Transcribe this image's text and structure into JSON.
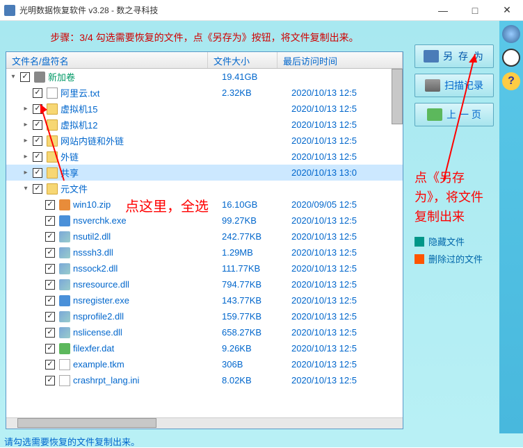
{
  "window": {
    "title": "光明数据恢复软件 v3.28 - 数之寻科技"
  },
  "step_text": "步骤：3/4 勾选需要恢复的文件，点《另存为》按钮，将文件复制出来。",
  "headers": {
    "name": "文件名/盘符名",
    "size": "文件大小",
    "time": "最后访问时间"
  },
  "files": [
    {
      "indent": 0,
      "expand": "▾",
      "icon": "disk",
      "name": "新加卷",
      "nameClass": "green",
      "size": "19.41GB",
      "time": ""
    },
    {
      "indent": 1,
      "expand": "",
      "icon": "txt",
      "name": "阿里云.txt",
      "size": "2.32KB",
      "time": "2020/10/13 12:5"
    },
    {
      "indent": 1,
      "expand": "▸",
      "icon": "folder",
      "name": "虚拟机15",
      "size": "",
      "time": "2020/10/13 12:5"
    },
    {
      "indent": 1,
      "expand": "▸",
      "icon": "folder",
      "name": "虚拟机12",
      "size": "",
      "time": "2020/10/13 12:5"
    },
    {
      "indent": 1,
      "expand": "▸",
      "icon": "folder",
      "name": "网站内链和外链",
      "size": "",
      "time": "2020/10/13 12:5"
    },
    {
      "indent": 1,
      "expand": "▸",
      "icon": "folder",
      "name": "外链",
      "size": "",
      "time": "2020/10/13 12:5"
    },
    {
      "indent": 1,
      "expand": "▸",
      "icon": "folder",
      "name": "共享",
      "size": "",
      "time": "2020/10/13 13:0",
      "selected": true
    },
    {
      "indent": 1,
      "expand": "▾",
      "icon": "folder",
      "name": "元文件",
      "size": "",
      "time": ""
    },
    {
      "indent": 2,
      "expand": "",
      "icon": "zip",
      "name": "win10.zip",
      "size": "16.10GB",
      "time": "2020/09/05 12:5"
    },
    {
      "indent": 2,
      "expand": "",
      "icon": "exe",
      "name": "nsverchk.exe",
      "size": "99.27KB",
      "time": "2020/10/13 12:5"
    },
    {
      "indent": 2,
      "expand": "",
      "icon": "dll",
      "name": "nsutil2.dll",
      "size": "242.77KB",
      "time": "2020/10/13 12:5"
    },
    {
      "indent": 2,
      "expand": "",
      "icon": "dll",
      "name": "nsssh3.dll",
      "size": "1.29MB",
      "time": "2020/10/13 12:5"
    },
    {
      "indent": 2,
      "expand": "",
      "icon": "dll",
      "name": "nssock2.dll",
      "size": "111.77KB",
      "time": "2020/10/13 12:5"
    },
    {
      "indent": 2,
      "expand": "",
      "icon": "dll",
      "name": "nsresource.dll",
      "size": "794.77KB",
      "time": "2020/10/13 12:5"
    },
    {
      "indent": 2,
      "expand": "",
      "icon": "exe",
      "name": "nsregister.exe",
      "size": "143.77KB",
      "time": "2020/10/13 12:5"
    },
    {
      "indent": 2,
      "expand": "",
      "icon": "dll",
      "name": "nsprofile2.dll",
      "size": "159.77KB",
      "time": "2020/10/13 12:5"
    },
    {
      "indent": 2,
      "expand": "",
      "icon": "dll",
      "name": "nslicense.dll",
      "size": "658.27KB",
      "time": "2020/10/13 12:5"
    },
    {
      "indent": 2,
      "expand": "",
      "icon": "dat",
      "name": "filexfer.dat",
      "size": "9.26KB",
      "time": "2020/10/13 12:5"
    },
    {
      "indent": 2,
      "expand": "",
      "icon": "gen",
      "name": "example.tkm",
      "size": "306B",
      "time": "2020/10/13 12:5"
    },
    {
      "indent": 2,
      "expand": "",
      "icon": "gen",
      "name": "crashrpt_lang.ini",
      "size": "8.02KB",
      "time": "2020/10/13 12:5"
    }
  ],
  "overlay_select": "点这里，全选",
  "buttons": {
    "save_as": "另 存 为",
    "scan_log": "扫描记录",
    "prev": "上 一 页"
  },
  "side_note": "点《另存为》，将文件复制出来",
  "legend": {
    "hidden": "隐藏文件",
    "deleted": "删除过的文件"
  },
  "status": "请勾选需要恢复的文件复制出来。",
  "help_glyph": "?"
}
